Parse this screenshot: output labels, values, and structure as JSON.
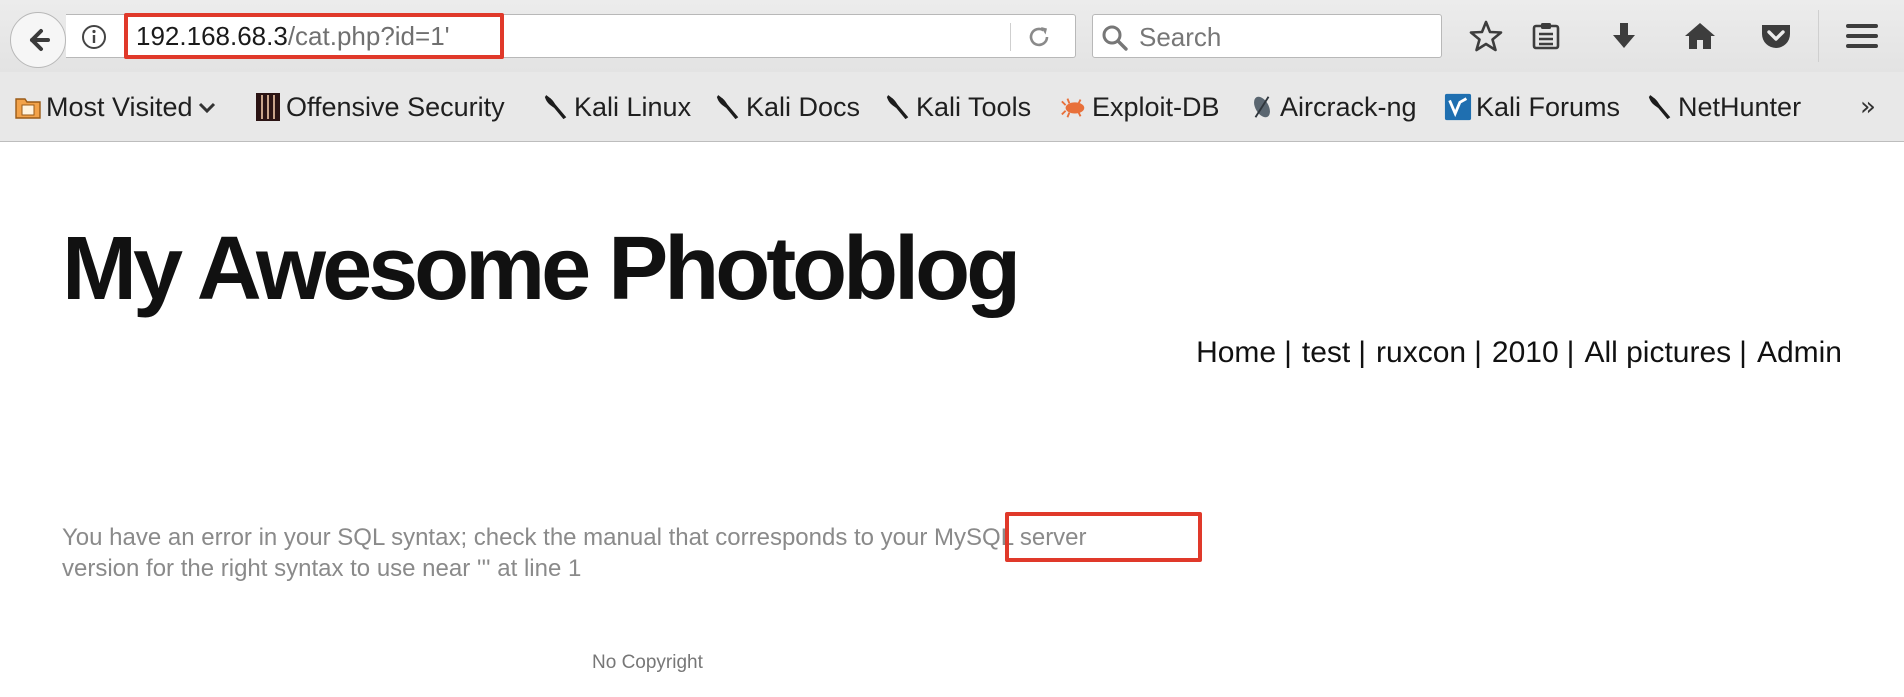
{
  "browser": {
    "url_host": "192.168.68.3",
    "url_path": "/cat.php?id=1'",
    "search_placeholder": "Search",
    "bookmarks": [
      {
        "label": "Most Visited",
        "icon": "folder-icon"
      },
      {
        "label": "Offensive Security",
        "icon": "offsec-icon"
      },
      {
        "label": "Kali Linux",
        "icon": "kali-dragon-icon"
      },
      {
        "label": "Kali Docs",
        "icon": "kali-dragon-icon"
      },
      {
        "label": "Kali Tools",
        "icon": "kali-dragon-icon"
      },
      {
        "label": "Exploit-DB",
        "icon": "exploit-db-icon"
      },
      {
        "label": "Aircrack-ng",
        "icon": "aircrack-icon"
      },
      {
        "label": "Kali Forums",
        "icon": "kali-forums-icon"
      },
      {
        "label": "NetHunter",
        "icon": "kali-dragon-icon"
      }
    ],
    "overflow_label": "»",
    "colors": {
      "highlight": "#e0392a",
      "exploit_icon": "#e8703a",
      "forums_icon": "#1f6fb0"
    }
  },
  "page": {
    "title": "My Awesome Photoblog",
    "nav": [
      "Home",
      "test",
      "ruxcon",
      "2010",
      "All pictures",
      "Admin"
    ],
    "nav_separator": "|",
    "error_before": "You have an error in your SQL syntax; check the manual that corresponds to your ",
    "error_highlight": "MySQL server",
    "error_after": " version for the right syntax to use near ''' at line 1",
    "footer": "No Copyright"
  }
}
